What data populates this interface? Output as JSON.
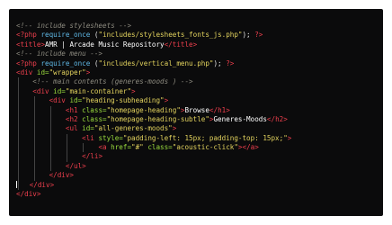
{
  "editor": {
    "l1": {
      "comment": "<!-- include stylesheets -->"
    },
    "l2": {
      "open": "<?php",
      "fn": "require_once",
      "lp": " (",
      "str": "\"includes/stylesheets_fonts_js.php\"",
      "rp": ");",
      "close": " ?>"
    },
    "l3": {
      "tag1": "<title>",
      "text": "AMR | Arcade Music Repository",
      "tag2": "</title>"
    },
    "l4": {
      "comment": "<!-- include menu -->"
    },
    "l5": {
      "open": "<?php",
      "fn": "require_once",
      "lp": " (",
      "str": "\"includes/vertical_menu.php\"",
      "rp": ");",
      "close": " ?>"
    },
    "l6": {
      "tag": "<div",
      "attr": " id=",
      "val": "\"wrapper\"",
      "end": ">"
    },
    "l7": {
      "comment": "<!-- main contents (generes-moods ) -->"
    },
    "l8": {
      "tag": "<div",
      "attr": " id=",
      "val": "\"main-container\"",
      "end": ">"
    },
    "l9": {
      "tag": "<div",
      "attr": " id=",
      "val": "\"heading-subheading\"",
      "end": ">"
    },
    "l10": {
      "tag": "<h1",
      "attr": " class=",
      "val": "\"homepage-heading\"",
      "end": ">",
      "text": "Browse",
      "close": "</h1>"
    },
    "l11": {
      "tag": "<h2",
      "attr": " class=",
      "val": "\"homepage-heading-subtle\"",
      "end": ">",
      "text": "Generes-Moods",
      "close": "</h2>"
    },
    "l12": {
      "tag": "<ul",
      "attr": " id=",
      "val": "\"all-generes-moods\"",
      "end": ">"
    },
    "l13": {
      "tag": "<li",
      "attr": " style=",
      "val": "\"padding-left: 15px; padding-top: 15px;\"",
      "end": ">"
    },
    "l14": {
      "tag": "<a",
      "attr1": " href=",
      "val1": "\"#\"",
      "attr2": " class=",
      "val2": "\"acoustic-click\"",
      "end": ">",
      "close": "</a>"
    },
    "l15": {
      "close": "</li>"
    },
    "l16": {
      "close": "</ul>"
    },
    "l17": {
      "close": "</div>"
    },
    "l18": {
      "close": "</div>"
    },
    "l19": {
      "close": "</div>"
    },
    "colors": {
      "background": "#0b0b0c",
      "comment": "#8c8a7f",
      "php_tag": "#ee3f4d",
      "function": "#5fb8e6",
      "string": "#e3d35e",
      "html_tag": "#ee3f4d",
      "attribute": "#9bdc3d",
      "text": "#ffffff"
    }
  }
}
